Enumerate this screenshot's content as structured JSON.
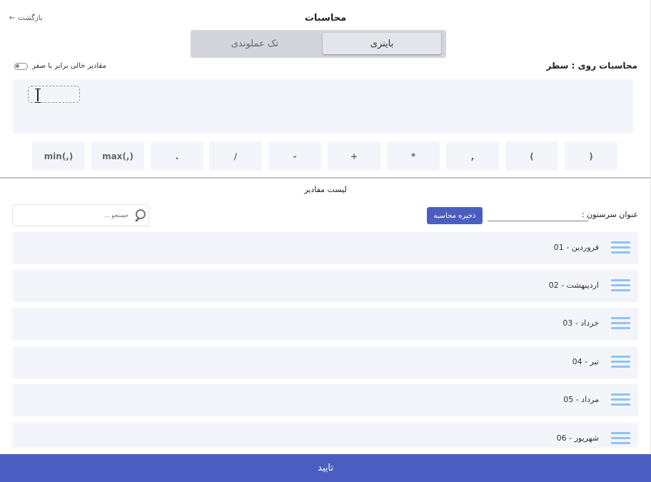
{
  "header": {
    "title": "محاسبات",
    "back_label": "بازگشت",
    "back_arrow": "←"
  },
  "mode_tabs": {
    "binary": "باینری",
    "unary": "تک عملوندی",
    "selected": "binary"
  },
  "options": {
    "empty_as_zero_label": "مقادیر خالی برابر با صفر",
    "empty_as_zero_enabled": false,
    "calc_on_label": "محاسبات روی : سطر"
  },
  "operators": [
    ")",
    "(",
    ",",
    "*",
    "+",
    "-",
    "/",
    ".",
    "max(,)",
    "min(,)"
  ],
  "values_list": {
    "title": "لیست مقادیر",
    "search_placeholder": "جستجو ...",
    "save_button": "ذخیره محاسبه",
    "column_title_label": "عنوان سرستون :",
    "column_title_value": "",
    "items": [
      "فروردین - 01",
      "اردیبهشت - 02",
      "خرداد - 03",
      "تیر - 04",
      "مرداد - 05",
      "شهریور - 06"
    ]
  },
  "footer": {
    "confirm_label": "تایید"
  },
  "colors": {
    "primary": "#4a5ec1",
    "panel_bg": "#f4f5fa",
    "segment_bg": "#d3d5dd",
    "drag_handle": "#8ec3f6"
  },
  "icons": {
    "back": "arrow-left-icon",
    "search": "search-icon",
    "drag": "drag-handle-icon",
    "cursor": "text-cursor-icon"
  }
}
